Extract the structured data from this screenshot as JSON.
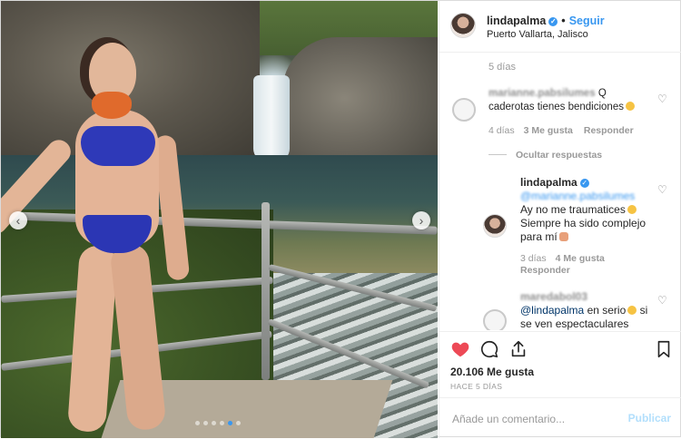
{
  "post_photo": {
    "alt": "",
    "carousel": {
      "dot_count": 6,
      "active_index": 4
    },
    "prev_glyph": "‹",
    "next_glyph": "›"
  },
  "header": {
    "username": "lindapalma",
    "verified_glyph": "✓",
    "separator": "•",
    "follow_label": "Seguir",
    "location": "Puerto Vallarta, Jalisco"
  },
  "comments": {
    "top_time": "5 días",
    "items": [
      {
        "username": "marianne.pabsilumes",
        "text": "Q caderotas tienes bendiciones",
        "time": "4 días",
        "likes": "3 Me gusta",
        "reply_label": "Responder",
        "emoji": "astonished-face"
      }
    ],
    "hide_replies_label": "Ocultar respuestas",
    "replies": [
      {
        "username": "lindapalma",
        "mention": "@marianne.pabsilumes",
        "text": "Ay no me traumatices",
        "text2": "Siempre ha sido complejo para mí",
        "time": "3 días",
        "likes": "4 Me gusta",
        "reply_label": "Responder",
        "emoji1": "smiling-face",
        "emoji2": "person-facepalming"
      },
      {
        "username": "maredabol03",
        "mention": "@lindapalma",
        "text": "en serio",
        "text2": "si se ven espectaculares",
        "emoji": "astonished-face"
      }
    ]
  },
  "actions": {
    "likes": "20.106 Me gusta",
    "posted_ago": "HACE 5 DÍAS"
  },
  "composer": {
    "placeholder": "Añade un comentario...",
    "publish_label": "Publicar"
  },
  "colors": {
    "accent": "#3897f0",
    "like_red": "#ed4956",
    "publish_disabled": "#b2dffc"
  }
}
